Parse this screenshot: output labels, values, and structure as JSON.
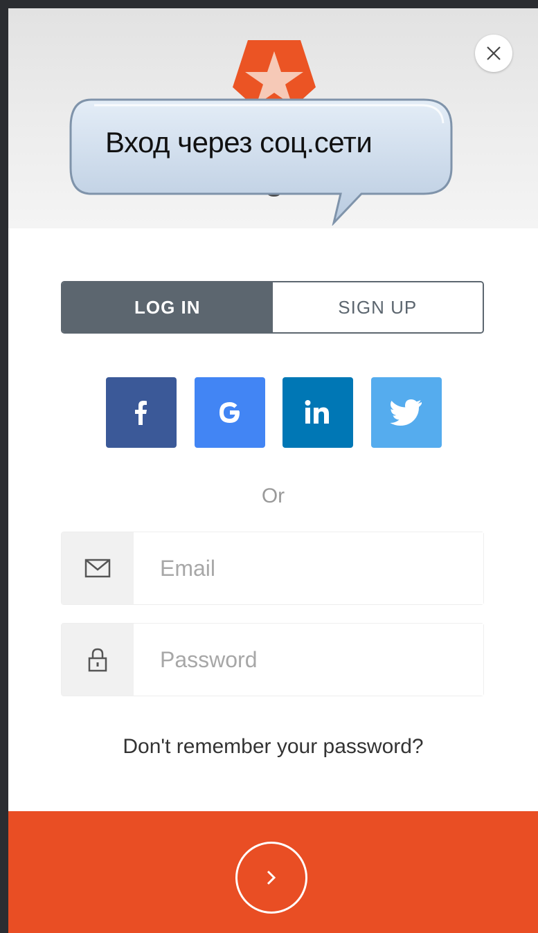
{
  "header": {
    "title": "Log in",
    "callout_text": "Вход через соц.сети"
  },
  "tabs": [
    {
      "label": "LOG IN",
      "active": true
    },
    {
      "label": "SIGN UP",
      "active": false
    }
  ],
  "social": [
    {
      "name": "facebook",
      "color": "#3b5998",
      "icon": "facebook-icon"
    },
    {
      "name": "google",
      "color": "#4285f4",
      "icon": "google-icon"
    },
    {
      "name": "linkedin",
      "color": "#0077b5",
      "icon": "linkedin-icon"
    },
    {
      "name": "twitter",
      "color": "#55acee",
      "icon": "twitter-icon"
    }
  ],
  "separator": "Or",
  "fields": {
    "email_placeholder": "Email",
    "password_placeholder": "Password"
  },
  "forgot_link": "Don't remember your password?",
  "colors": {
    "accent": "#e94e24",
    "tab_active": "#5c666f"
  }
}
